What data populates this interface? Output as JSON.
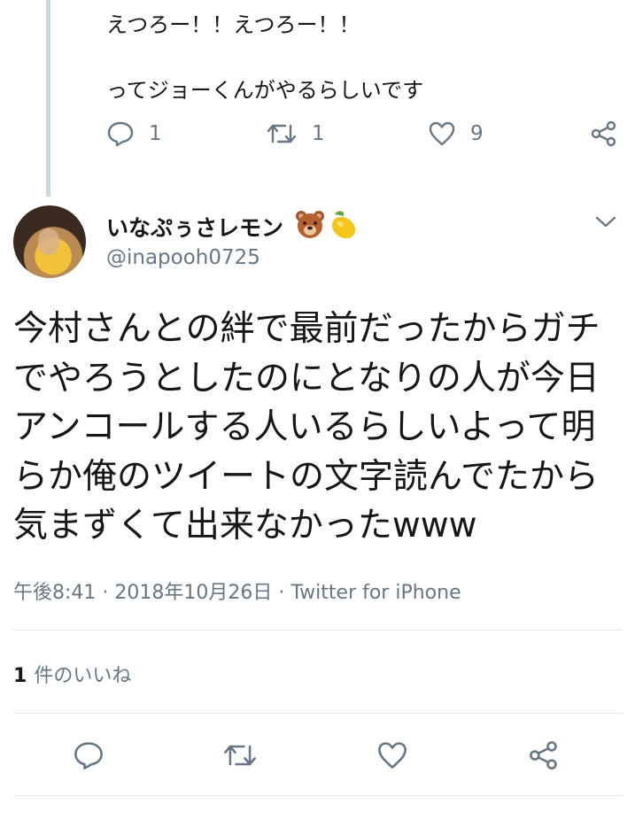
{
  "previous_tweet": {
    "line1": "えつろー！！えつろー！！",
    "line2": "ってジョーくんがやるらしいです",
    "reply_count": "1",
    "retweet_count": "1",
    "like_count": "9"
  },
  "tweet": {
    "display_name": "いなぷぅさレモン",
    "name_emojis": [
      "bear-face-emoji",
      "lemon-emoji"
    ],
    "handle": "@inapooh0725",
    "text": "今村さんとの絆で最前だったからガチ\nでやろうとしたのにとなりの人が今日\nアンコールする人いるらしいよって明\nらか俺のツイートの文字読んでたから\n気まずくて出来なかったwww",
    "timestamp": "午後8:41 · 2018年10月26日",
    "source_separator": "·",
    "source": "Twitter for iPhone",
    "likes_count": "1",
    "likes_label": "件のいいね"
  },
  "colors": {
    "text": "#14171a",
    "secondary": "#657786",
    "divider": "#e1e8ed",
    "thread_line": "#ccd6dd"
  }
}
